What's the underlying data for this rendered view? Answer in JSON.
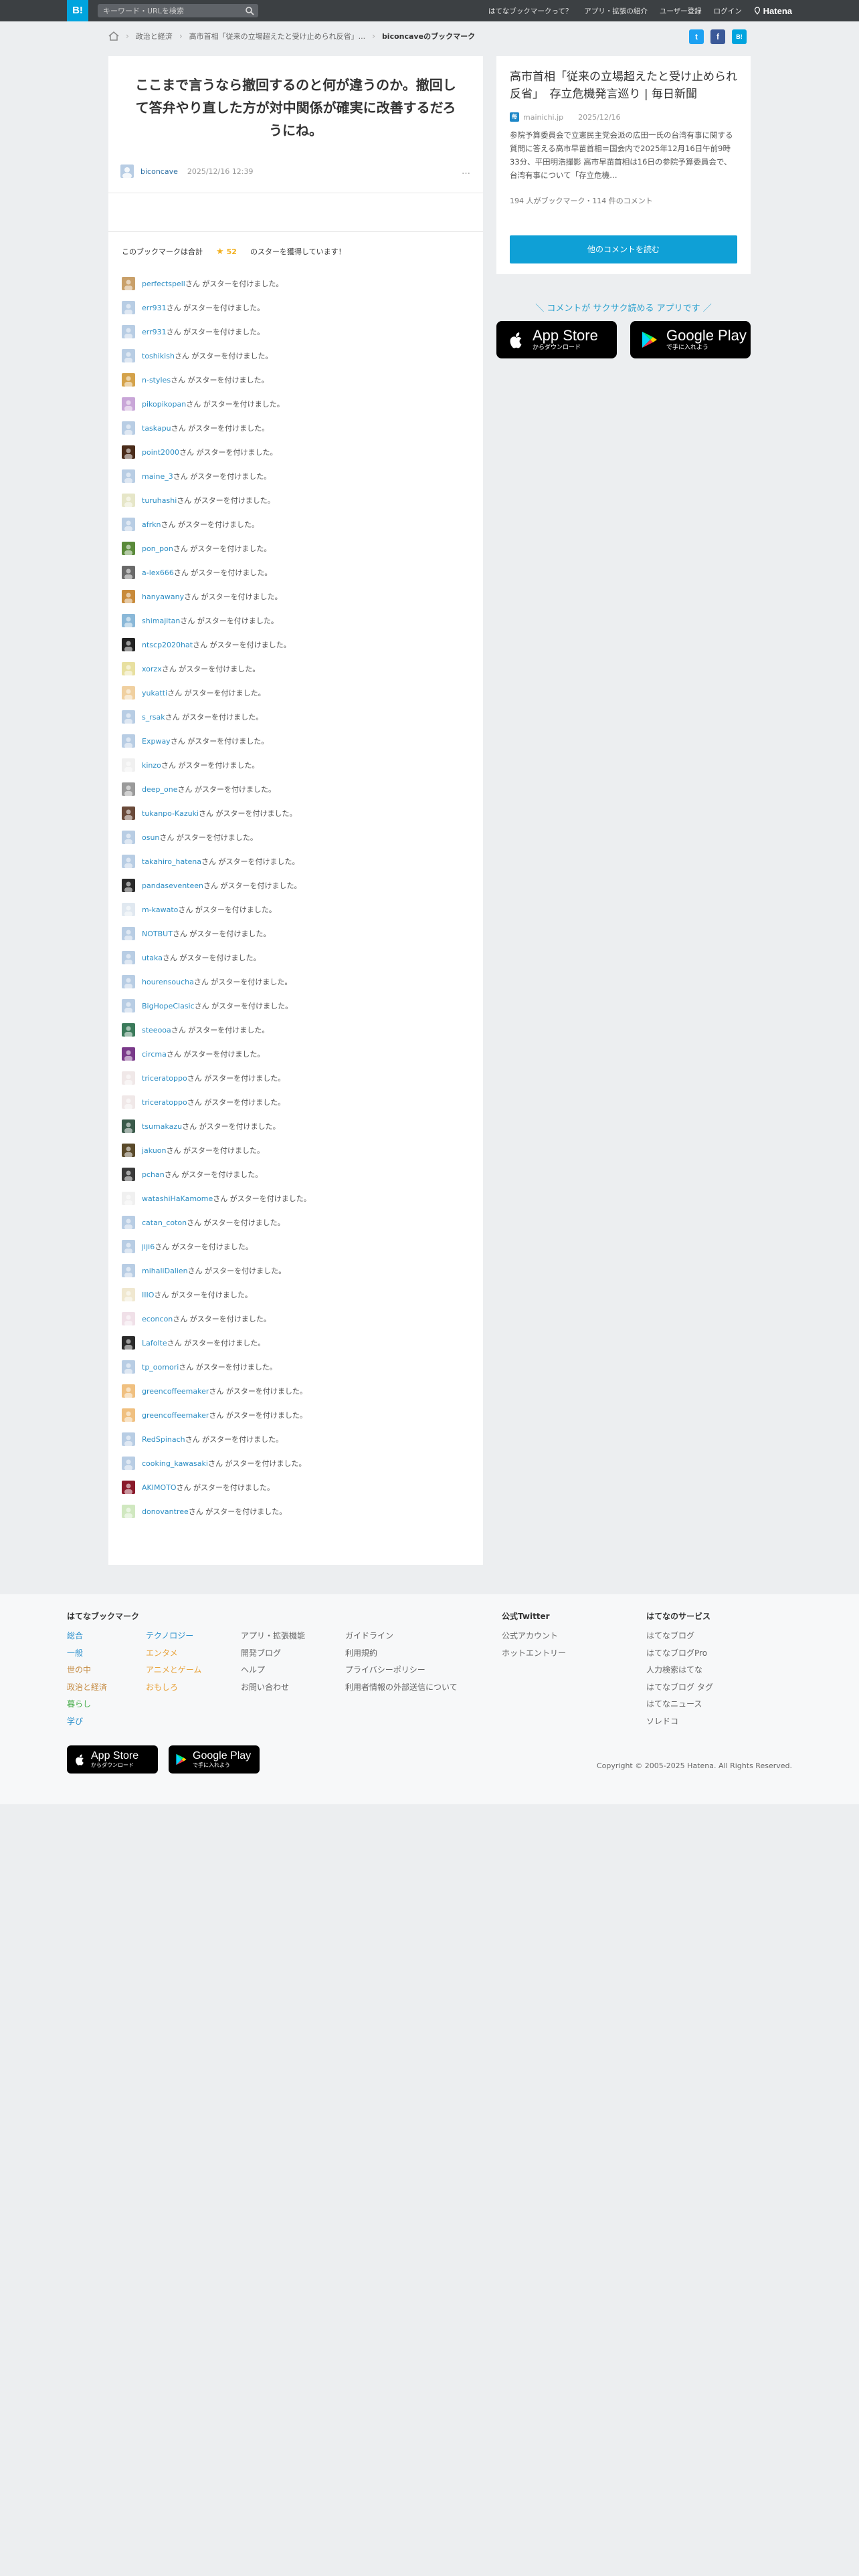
{
  "header": {
    "logo": "B!",
    "search_placeholder": "キーワード・URLを検索",
    "nav": [
      "はてなブックマークって？",
      "アプリ・拡張の紹介",
      "ユーザー登録",
      "ログイン"
    ],
    "brand": "Hatena"
  },
  "breadcrumb": {
    "items": [
      "政治と経済",
      "高市首相「従来の立場超えたと受け止められ反省」..."
    ],
    "current": "biconcaveのブックマーク"
  },
  "share": {
    "twitter": "t",
    "facebook": "f",
    "hatebu": "B!"
  },
  "comment": {
    "text": "ここまで言うなら撤回するのと何が違うのか。撤回して答弁やり直した方が対中関係が確実に改善するだろうにね。",
    "user": "biconcave",
    "date": "2025/12/16 12:39",
    "more": "…"
  },
  "stars": {
    "summary_prefix": "このブックマークは合計",
    "star_icon": "★",
    "count": "52",
    "summary_suffix": "のスターを獲得しています！",
    "suffix": "さん がスターを付けました。",
    "users": [
      {
        "name": "perfectspell",
        "color": "#c9a06a"
      },
      {
        "name": "err931",
        "color": "#b8cde4"
      },
      {
        "name": "err931",
        "color": "#b8cde4"
      },
      {
        "name": "toshikish",
        "color": "#b8cde4"
      },
      {
        "name": "n-styles",
        "color": "#d4a24a"
      },
      {
        "name": "pikopikopan",
        "color": "#c9a6d8"
      },
      {
        "name": "taskapu",
        "color": "#b8cde4"
      },
      {
        "name": "point2000",
        "color": "#4a2c1a"
      },
      {
        "name": "maine_3",
        "color": "#b8cde4"
      },
      {
        "name": "turuhashi",
        "color": "#e6e6c8"
      },
      {
        "name": "afrkn",
        "color": "#b8cde4"
      },
      {
        "name": "pon_pon",
        "color": "#5a8a3a"
      },
      {
        "name": "a-lex666",
        "color": "#6a6a6a"
      },
      {
        "name": "hanyawany",
        "color": "#c88a3a"
      },
      {
        "name": "shimajitan",
        "color": "#8ab8d8"
      },
      {
        "name": "ntscp2020hat",
        "color": "#222222"
      },
      {
        "name": "xorzx",
        "color": "#e8e0a0"
      },
      {
        "name": "yukatti",
        "color": "#f0d0a0"
      },
      {
        "name": "s_rsak",
        "color": "#b8cde4"
      },
      {
        "name": "Expway",
        "color": "#b8cde4"
      },
      {
        "name": "kinzo",
        "color": "#f0f0f0"
      },
      {
        "name": "deep_one",
        "color": "#9a9a9a"
      },
      {
        "name": "tukanpo-Kazuki",
        "color": "#6a4a3a"
      },
      {
        "name": "osun",
        "color": "#b8cde4"
      },
      {
        "name": "takahiro_hatena",
        "color": "#b8cde4"
      },
      {
        "name": "pandaseventeen",
        "color": "#2a2a2a"
      },
      {
        "name": "m-kawato",
        "color": "#e0e8f0"
      },
      {
        "name": "NOTBUT",
        "color": "#b8cde4"
      },
      {
        "name": "utaka",
        "color": "#b8cde4"
      },
      {
        "name": "hourensoucha",
        "color": "#b8cde4"
      },
      {
        "name": "BigHopeClasic",
        "color": "#b8cde4"
      },
      {
        "name": "steeooa",
        "color": "#3a7a5a"
      },
      {
        "name": "circma",
        "color": "#7a3a8a"
      },
      {
        "name": "triceratoppo",
        "color": "#f0e8e8"
      },
      {
        "name": "triceratoppo",
        "color": "#f0e8e8"
      },
      {
        "name": "tsumakazu",
        "color": "#3a5a4a"
      },
      {
        "name": "jakuon",
        "color": "#5a4a2a"
      },
      {
        "name": "pchan",
        "color": "#3a3a3a"
      },
      {
        "name": "watashiHaKamome",
        "color": "#f0f0f0"
      },
      {
        "name": "catan_coton",
        "color": "#b8cde4"
      },
      {
        "name": "jiji6",
        "color": "#b8cde4"
      },
      {
        "name": "mihaliDalien",
        "color": "#b8cde4"
      },
      {
        "name": "IIIO",
        "color": "#f0e8d0"
      },
      {
        "name": "econcon",
        "color": "#f0e0e8"
      },
      {
        "name": "Lafolte",
        "color": "#2a2a2a"
      },
      {
        "name": "tp_oomori",
        "color": "#b8cde4"
      },
      {
        "name": "greencoffeemaker",
        "color": "#f0c080"
      },
      {
        "name": "greencoffeemaker",
        "color": "#f0c080"
      },
      {
        "name": "RedSpinach",
        "color": "#b8cde4"
      },
      {
        "name": "cooking_kawasaki",
        "color": "#b8cde4"
      },
      {
        "name": "AKIMOTO",
        "color": "#8a1a2a"
      },
      {
        "name": "donovantree",
        "color": "#d0e8c0"
      }
    ]
  },
  "entry": {
    "title": "高市首相「従来の立場超えたと受け止められ反省」　存立危機発言巡り | 毎日新聞",
    "favicon": "毎",
    "site": "mainichi.jp",
    "date": "2025/12/16",
    "description": "参院予算委員会で立憲民主党会派の広田一氏の台湾有事に関する質問に答える高市早苗首相＝国会内で2025年12月16日午前9時33分、平田明浩撮影 高市早苗首相は16日の参院予算委員会で、台湾有事について「存立危機…",
    "counts": "194 人がブックマーク・114 件のコメント",
    "button": "他のコメントを読む"
  },
  "promo": {
    "text": "＼ コメントが サクサク読める アプリです ／",
    "appstore_small": "からダウンロード",
    "appstore_big": "App Store",
    "googleplay_big": "Google Play",
    "googleplay_small": "で手に入れよう"
  },
  "footer": {
    "section_title": "はてなブックマーク",
    "categories_col1": [
      "総合",
      "一般",
      "世の中",
      "政治と経済",
      "暮らし",
      "学び"
    ],
    "categories_col2": [
      "テクノロジー",
      "エンタメ",
      "アニメとゲーム",
      "おもしろ"
    ],
    "links_col3": [
      "アプリ・拡張機能",
      "開発ブログ",
      "ヘルプ",
      "お問い合わせ"
    ],
    "links_col4": [
      "ガイドライン",
      "利用規約",
      "プライバシーポリシー",
      "利用者情報の外部送信について"
    ],
    "twitter_title": "公式Twitter",
    "twitter_links": [
      "公式アカウント",
      "ホットエントリー"
    ],
    "services_title": "はてなのサービス",
    "services": [
      "はてなブログ",
      "はてなブログPro",
      "人力検索はてな",
      "はてなブログ タグ",
      "はてなニュース",
      "ソレドコ"
    ],
    "copyright": "Copyright © 2005-2025 Hatena. All Rights Reserved."
  },
  "colors": {
    "accent": "#00a4de",
    "button": "#0fa0d6",
    "link": "#2d8ec4",
    "star": "#f2b01e",
    "header_bg": "#3c4043"
  }
}
